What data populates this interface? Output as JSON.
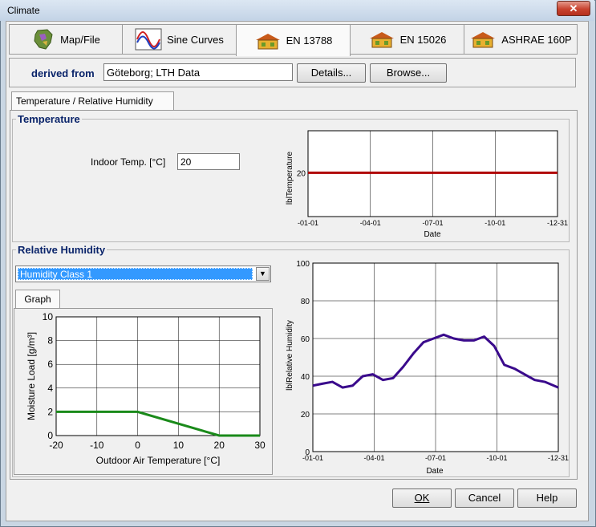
{
  "window": {
    "title": "Climate",
    "close_label": "✕"
  },
  "tabs": [
    {
      "label": "Map/File",
      "icon": "map-icon"
    },
    {
      "label": "Sine Curves",
      "icon": "sine-curves-icon"
    },
    {
      "label": "EN 13788",
      "icon": "house-icon",
      "active": true
    },
    {
      "label": "EN 15026",
      "icon": "house-icon"
    },
    {
      "label": "ASHRAE 160P",
      "icon": "house-icon"
    }
  ],
  "derived": {
    "label": "derived from",
    "value": "Göteborg; LTH Data",
    "details_label": "Details...",
    "browse_label": "Browse..."
  },
  "subtab": {
    "label": "Temperature / Relative Humidity"
  },
  "temperature": {
    "group_title": "Temperature",
    "indoor_label": "Indoor Temp. [°C]",
    "indoor_value": "20"
  },
  "humidity": {
    "group_title": "Relative Humidity",
    "selected_class": "Humidity Class 1",
    "graph_tab_label": "Graph"
  },
  "footer": {
    "ok_label": "OK",
    "cancel_label": "Cancel",
    "help_label": "Help"
  },
  "colors": {
    "temp_line": "#b00000",
    "rh_line": "#3a0a8c",
    "moisture_line": "#1a8a1a",
    "heading": "#0a246a"
  },
  "chart_data": [
    {
      "id": "temperature-chart",
      "type": "line",
      "ylabel": "lblTemperature",
      "xlabel": "Date",
      "x_ticks": [
        "-01-01",
        "-04-01",
        "-07-01",
        "-10-01",
        "-12-31"
      ],
      "y_ticks": [
        "20"
      ],
      "series": [
        {
          "values": [
            20,
            20,
            20,
            20,
            20
          ]
        }
      ]
    },
    {
      "id": "moisture-chart",
      "type": "line",
      "xlabel": "Outdoor Air Temperature [°C]",
      "ylabel": "Moisture Load [g/m³]",
      "xlim": [
        -20,
        30
      ],
      "ylim": [
        0,
        10
      ],
      "x_ticks": [
        "-20",
        "-10",
        "0",
        "10",
        "20",
        "30"
      ],
      "y_ticks": [
        "0",
        "2",
        "4",
        "6",
        "8",
        "10"
      ],
      "series": [
        {
          "x": [
            -20,
            0,
            20,
            30
          ],
          "y": [
            2,
            2,
            0,
            0
          ]
        }
      ]
    },
    {
      "id": "rh-chart",
      "type": "line",
      "ylabel": "lblRelative Humidity",
      "xlabel": "Date",
      "ylim": [
        0,
        100
      ],
      "x_ticks": [
        "-01-01",
        "-04-01",
        "-07-01",
        "-10-01",
        "-12-31"
      ],
      "y_ticks": [
        "0",
        "20",
        "40",
        "60",
        "80",
        "100"
      ],
      "series": [
        {
          "doy": [
            1,
            15,
            30,
            45,
            60,
            75,
            90,
            105,
            120,
            135,
            150,
            165,
            180,
            195,
            210,
            225,
            240,
            255,
            270,
            285,
            300,
            315,
            330,
            345,
            365
          ],
          "values": [
            35,
            36,
            37,
            34,
            35,
            40,
            41,
            38,
            39,
            45,
            52,
            58,
            60,
            62,
            60,
            59,
            59,
            61,
            56,
            46,
            44,
            41,
            38,
            37,
            34
          ]
        }
      ]
    }
  ]
}
